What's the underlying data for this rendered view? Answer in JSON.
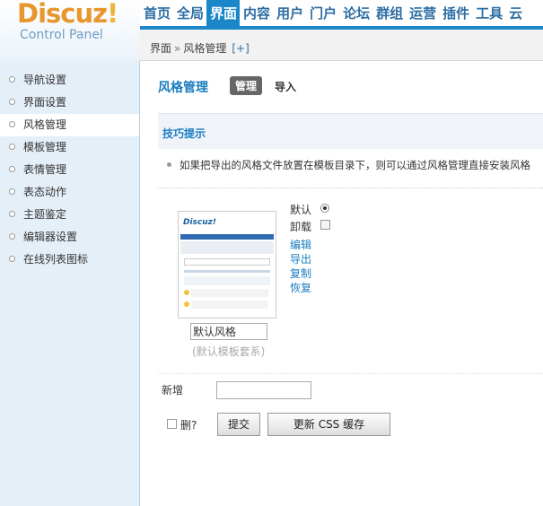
{
  "logo": {
    "name": "Discuz",
    "mark": "!",
    "subtitle": "Control Panel"
  },
  "topnav": {
    "items": [
      "首页",
      "全局",
      "界面",
      "内容",
      "用户",
      "门户",
      "论坛",
      "群组",
      "运营",
      "插件",
      "工具",
      "云"
    ],
    "active_index": 2
  },
  "breadcrumb": {
    "parent": "界面",
    "separator": "»",
    "current": "风格管理",
    "plus": "[+]"
  },
  "sidebar": {
    "items": [
      "导航设置",
      "界面设置",
      "风格管理",
      "模板管理",
      "表情管理",
      "表态动作",
      "主题鉴定",
      "编辑器设置",
      "在线列表图标"
    ],
    "active_index": 2
  },
  "main": {
    "title": "风格管理",
    "tabs": {
      "manage": "管理",
      "import": "导入"
    },
    "tips": {
      "title": "技巧提示",
      "text": "如果把导出的风格文件放置在模板目录下，则可以通过风格管理直接安装风格"
    },
    "style": {
      "name_value": "默认风格",
      "template_set": "(默认模板套系)",
      "default_label": "默认",
      "uninstall_label": "卸载",
      "actions": {
        "edit": "编辑",
        "export": "导出",
        "copy": "复制",
        "restore": "恢复"
      },
      "thumb": {
        "logo": "Discuz!"
      }
    },
    "new_label": "新增",
    "new_value": "",
    "delete_label": "删?",
    "submit_label": "提交",
    "cache_label": "更新 CSS 缓存"
  },
  "colors": {
    "accent": "#1a88c8",
    "link": "#1a7dc0",
    "logo": "#e8962e",
    "sidebar_bg": "#e5eff7"
  }
}
